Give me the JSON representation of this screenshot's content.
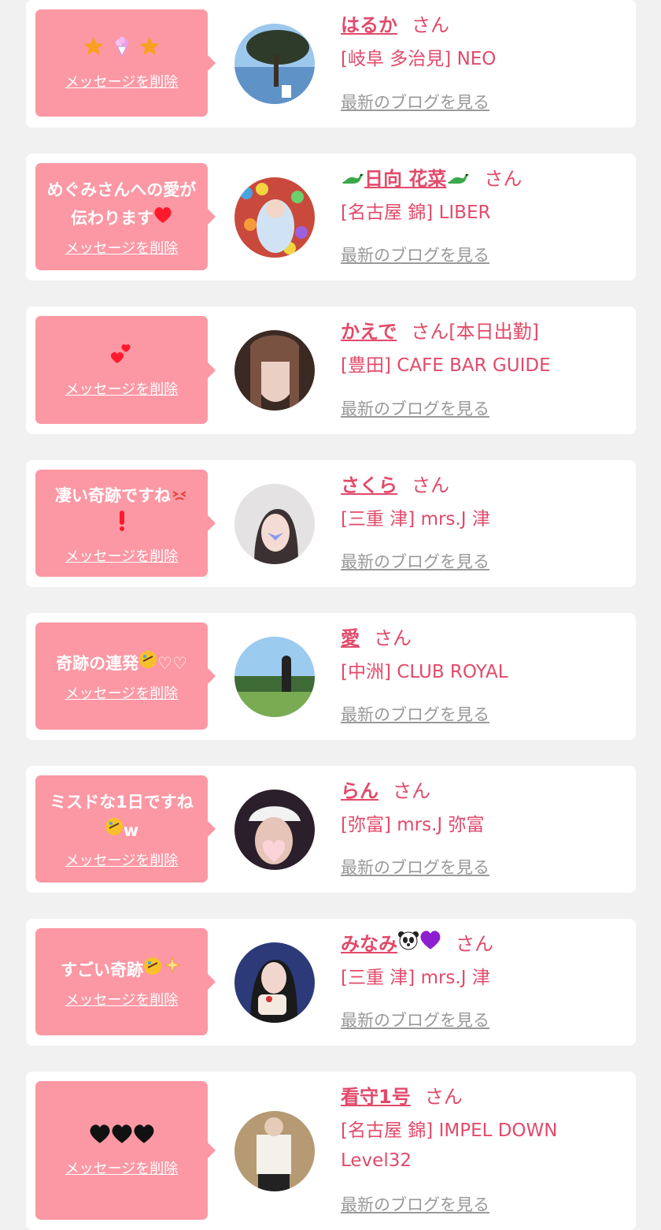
{
  "common": {
    "delete_label": "メッセージを削除",
    "blog_label": "最新のブログを見る",
    "honorific": "さん"
  },
  "items": [
    {
      "message": "",
      "message_icons": [
        "star",
        "bouquet",
        "star"
      ],
      "name": "はるか",
      "name_suffix": "",
      "status": "",
      "shop": "[岐阜 多治見] NEO",
      "avatar": "sky-tree"
    },
    {
      "message": "めぐみさんへの愛が伝わります",
      "message_icons": [
        "red-heart"
      ],
      "name": "日向 花菜",
      "name_icons": [
        "dinosaur",
        "dinosaur"
      ],
      "status": "",
      "shop": "[名古屋 錦] LIBER",
      "avatar": "ball-pit"
    },
    {
      "message": "",
      "message_icons": [
        "two-hearts"
      ],
      "name": "かえで",
      "status": "[本日出勤]",
      "shop": "[豊田] CAFE BAR GUIDE",
      "avatar": "portrait-dark-hair"
    },
    {
      "message": "凄い奇跡ですね",
      "message_icons": [
        "tired-face",
        "exclamation"
      ],
      "name": "さくら",
      "status": "",
      "shop": "[三重 津] mrs.J 津",
      "avatar": "portrait-butterfly"
    },
    {
      "message": "奇跡の連発",
      "message_icons": [
        "rofl",
        "white-heart",
        "white-heart"
      ],
      "name": "愛",
      "status": "",
      "shop": "[中洲] CLUB ROYAL",
      "avatar": "golf-course"
    },
    {
      "message": "ミスドな1日ですね",
      "message_icons": [
        "rofl"
      ],
      "message_tail": "w",
      "name": "らん",
      "status": "",
      "shop": "[弥富] mrs.J 弥富",
      "avatar": "portrait-heart-sticker"
    },
    {
      "message": "すごい奇跡",
      "message_icons": [
        "rofl",
        "sparkles"
      ],
      "name": "みなみ",
      "name_icons": [
        "panda",
        "purple-heart"
      ],
      "status": "",
      "shop": "[三重 津] mrs.J 津",
      "avatar": "portrait-cake"
    },
    {
      "message": "",
      "message_icons": [
        "black-heart",
        "black-heart",
        "black-heart"
      ],
      "name": "看守1号",
      "status": "",
      "shop": "[名古屋 錦] IMPEL DOWN Level32",
      "avatar": "portrait-uniform"
    }
  ]
}
